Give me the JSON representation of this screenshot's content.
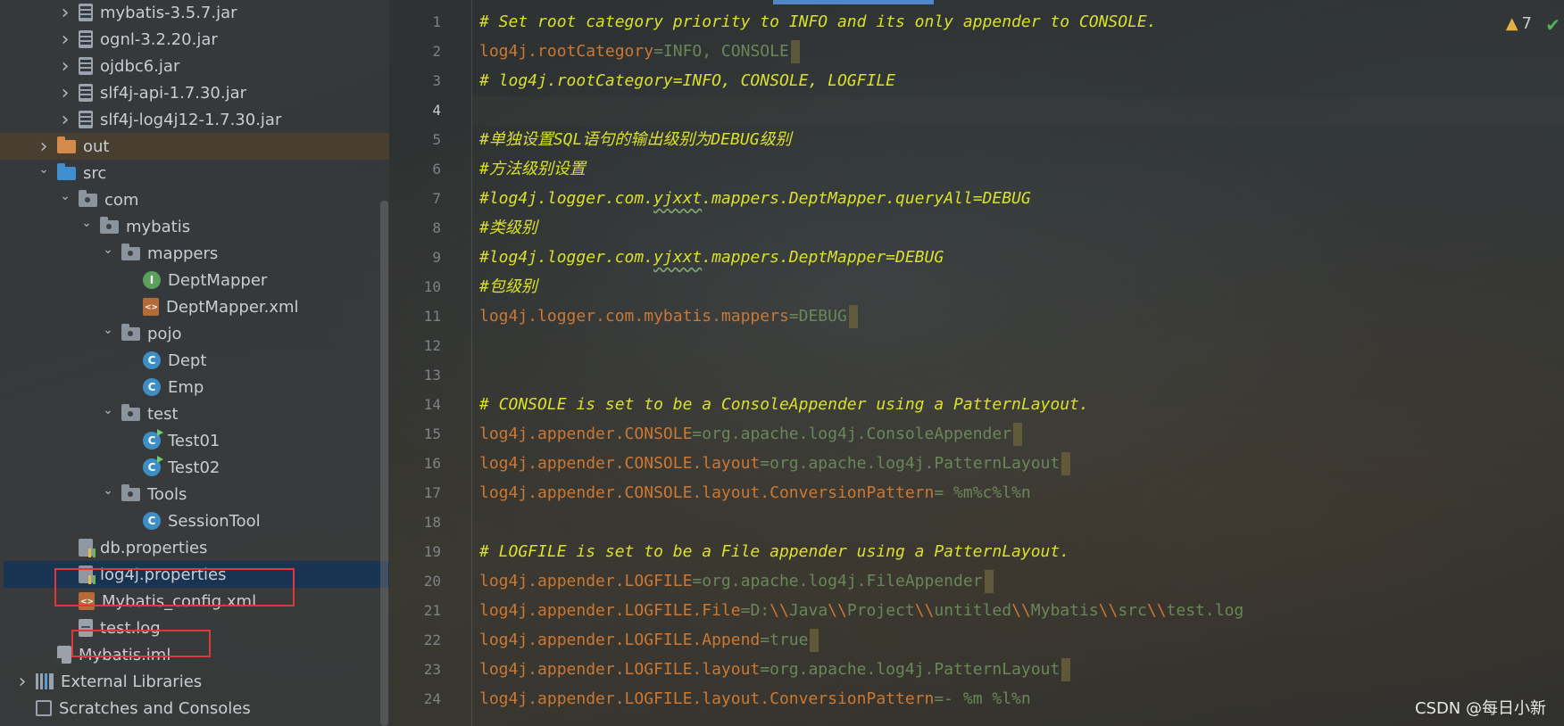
{
  "tree": {
    "items": [
      {
        "label": "mybatis-3.5.7.jar",
        "icon": "jar-icon",
        "level": 2,
        "chevron": "right"
      },
      {
        "label": "ognl-3.2.20.jar",
        "icon": "jar-icon",
        "level": 2,
        "chevron": "right"
      },
      {
        "label": "ojdbc6.jar",
        "icon": "jar-icon",
        "level": 2,
        "chevron": "right"
      },
      {
        "label": "slf4j-api-1.7.30.jar",
        "icon": "jar-icon",
        "level": 2,
        "chevron": "right"
      },
      {
        "label": "slf4j-log4j12-1.7.30.jar",
        "icon": "jar-icon",
        "level": 2,
        "chevron": "right"
      },
      {
        "label": "out",
        "icon": "folder-orange-icon",
        "level": 1,
        "chevron": "right"
      },
      {
        "label": "src",
        "icon": "folder-blue-icon",
        "level": 1,
        "chevron": "down"
      },
      {
        "label": "com",
        "icon": "package-icon",
        "level": 2,
        "chevron": "down"
      },
      {
        "label": "mybatis",
        "icon": "package-icon",
        "level": 3,
        "chevron": "down"
      },
      {
        "label": "mappers",
        "icon": "package-icon",
        "level": 4,
        "chevron": "down"
      },
      {
        "label": "DeptMapper",
        "icon": "interface-icon",
        "level": 5,
        "chevron": "none"
      },
      {
        "label": "DeptMapper.xml",
        "icon": "xml-file-icon",
        "level": 5,
        "chevron": "none"
      },
      {
        "label": "pojo",
        "icon": "package-icon",
        "level": 4,
        "chevron": "down"
      },
      {
        "label": "Dept",
        "icon": "class-icon",
        "level": 5,
        "chevron": "none"
      },
      {
        "label": "Emp",
        "icon": "class-icon",
        "level": 5,
        "chevron": "none"
      },
      {
        "label": "test",
        "icon": "package-icon",
        "level": 4,
        "chevron": "down"
      },
      {
        "label": "Test01",
        "icon": "runnable-class-icon",
        "level": 5,
        "chevron": "none"
      },
      {
        "label": "Test02",
        "icon": "runnable-class-icon",
        "level": 5,
        "chevron": "none"
      },
      {
        "label": "Tools",
        "icon": "package-icon",
        "level": 4,
        "chevron": "down"
      },
      {
        "label": "SessionTool",
        "icon": "class-icon",
        "level": 5,
        "chevron": "none"
      },
      {
        "label": "db.properties",
        "icon": "properties-file-icon",
        "level": 2,
        "chevron": "none"
      },
      {
        "label": "log4j.properties",
        "icon": "properties-file-icon",
        "level": 2,
        "chevron": "none"
      },
      {
        "label": "Mybatis_config.xml",
        "icon": "xml-file-icon",
        "level": 2,
        "chevron": "none"
      },
      {
        "label": "test.log",
        "icon": "text-file-icon",
        "level": 2,
        "chevron": "none"
      },
      {
        "label": "Mybatis.iml",
        "icon": "iml-file-icon",
        "level": 1,
        "chevron": "none"
      },
      {
        "label": "External Libraries",
        "icon": "libraries-icon",
        "level": 0,
        "chevron": "right"
      },
      {
        "label": "Scratches and Consoles",
        "icon": "scratches-icon",
        "level": 0,
        "chevron": "none"
      }
    ]
  },
  "editor": {
    "lines": [
      "# Set root category priority to INFO and its only appender to CONSOLE.",
      "log4j.rootCategory=INFO, CONSOLE",
      "# log4j.rootCategory=INFO, CONSOLE, LOGFILE",
      "",
      "#单独设置SQL语句的输出级别为DEBUG级别",
      "#方法级别设置",
      "#log4j.logger.com.yjxxt.mappers.DeptMapper.queryAll=DEBUG",
      "#类级别",
      "#log4j.logger.com.yjxxt.mappers.DeptMapper=DEBUG",
      "#包级别",
      "log4j.logger.com.mybatis.mappers=DEBUG",
      "",
      "",
      "# CONSOLE is set to be a ConsoleAppender using a PatternLayout.",
      "log4j.appender.CONSOLE=org.apache.log4j.ConsoleAppender",
      "log4j.appender.CONSOLE.layout=org.apache.log4j.PatternLayout",
      "log4j.appender.CONSOLE.layout.ConversionPattern= %m%c%l%n",
      "",
      "# LOGFILE is set to be a File appender using a PatternLayout.",
      "log4j.appender.LOGFILE=org.apache.log4j.FileAppender",
      "log4j.appender.LOGFILE.File=D:\\\\Java\\\\Project\\\\untitled\\\\Mybatis\\\\src\\\\test.log",
      "log4j.appender.LOGFILE.Append=true",
      "log4j.appender.LOGFILE.layout=org.apache.log4j.PatternLayout",
      "log4j.appender.LOGFILE.layout.ConversionPattern=- %m %l%n"
    ],
    "current_line": 4,
    "warning_count": "7"
  },
  "watermark": "CSDN @每日小新",
  "colors": {
    "comment": "#d9e02a",
    "key": "#cc7832",
    "value": "#6a8759",
    "selection": "#173456",
    "highlight_box": "#e0373b"
  }
}
